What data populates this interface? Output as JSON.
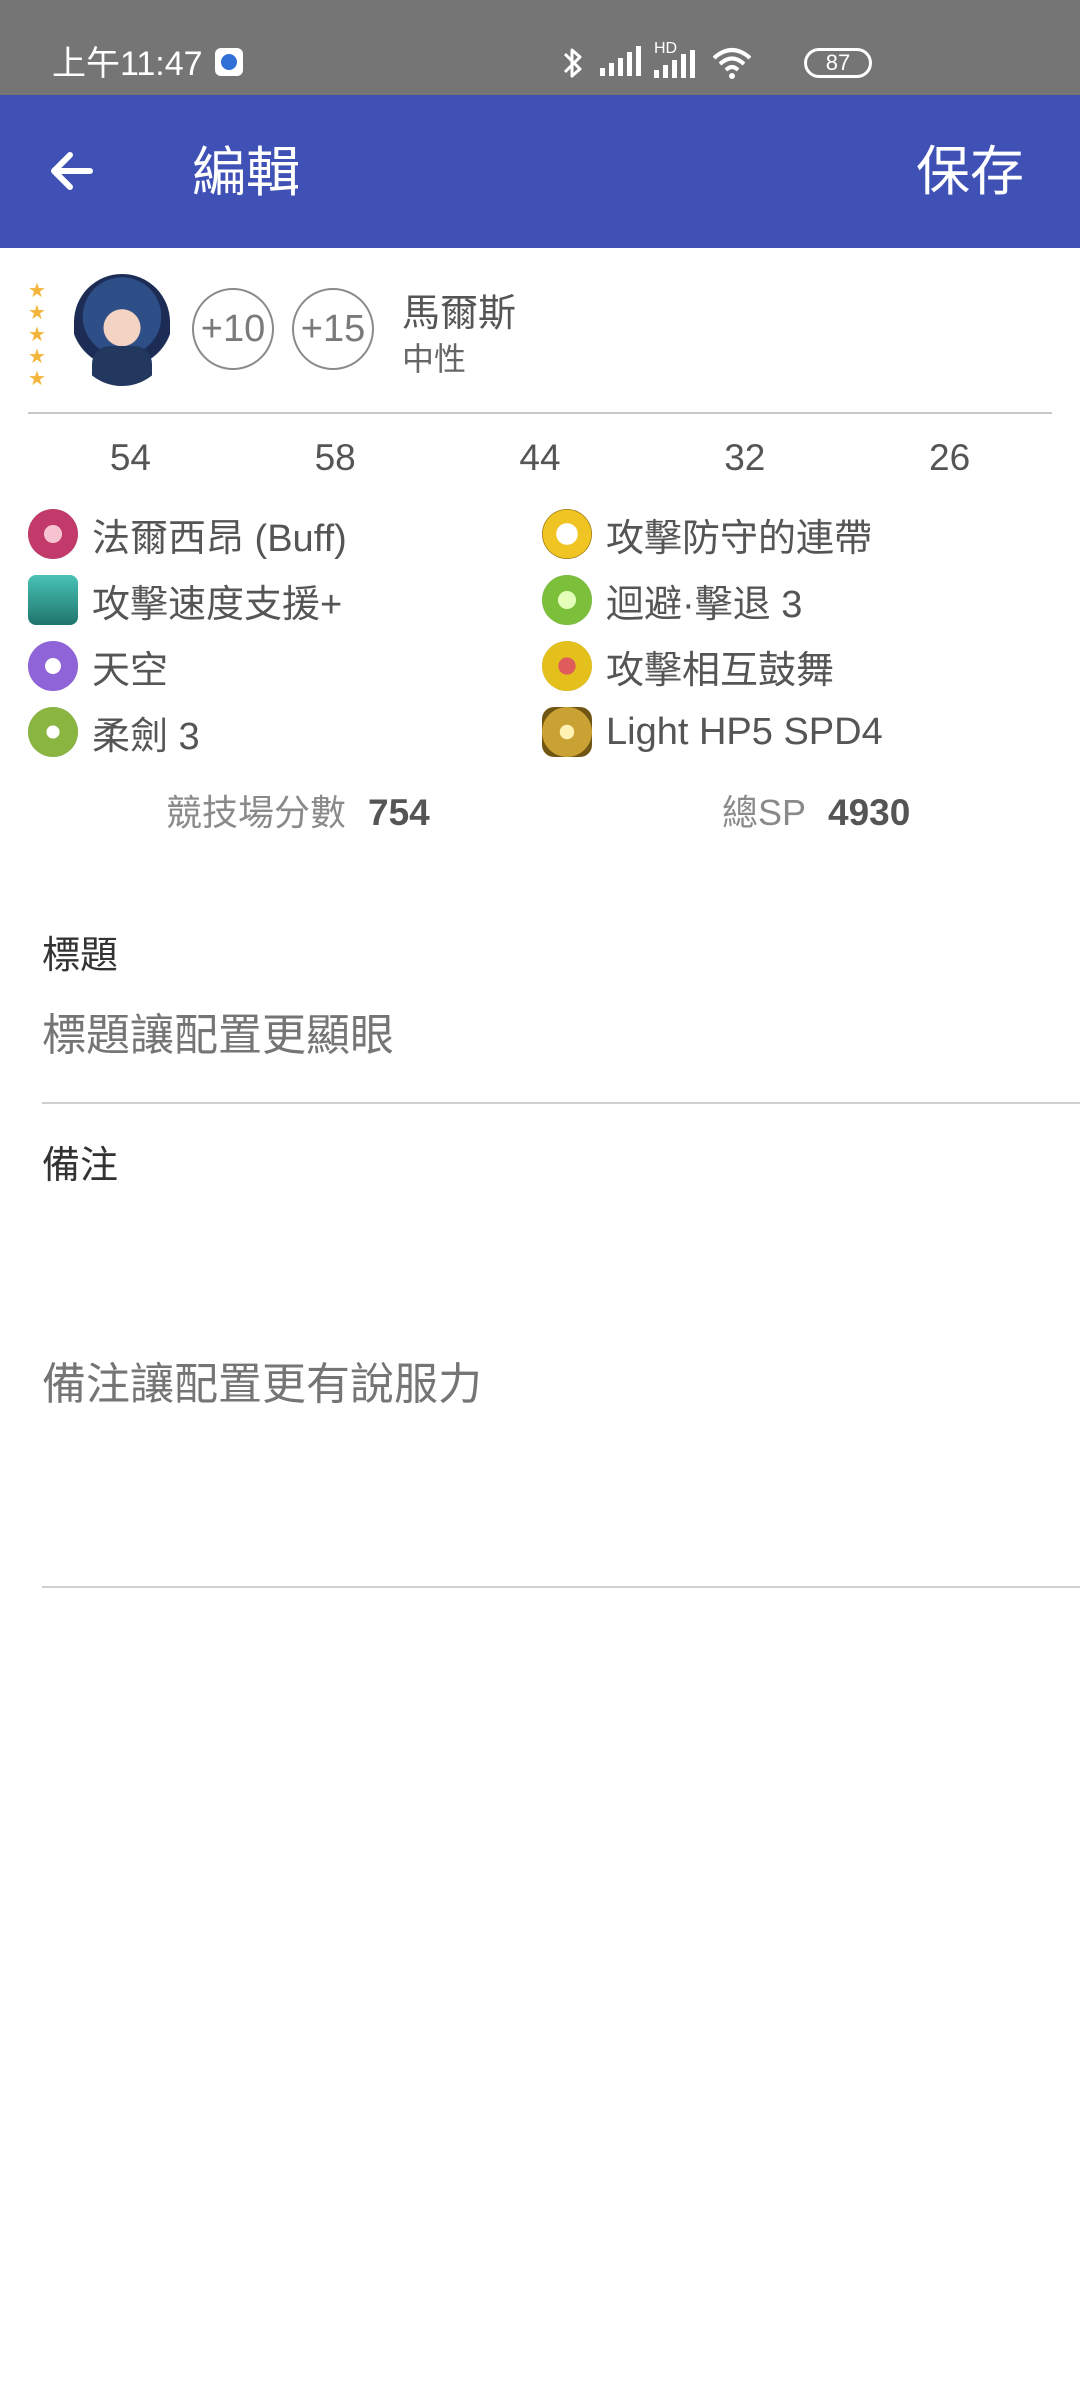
{
  "status_bar": {
    "time": "上午11:47",
    "battery": "87",
    "network_label": "HD"
  },
  "app_bar": {
    "title": "編輯",
    "save_label": "保存"
  },
  "hero": {
    "rarity_stars": 5,
    "merges": [
      "+10",
      "+15"
    ],
    "name": "馬爾斯",
    "type": "中性"
  },
  "stats": [
    "54",
    "58",
    "44",
    "32",
    "26"
  ],
  "skills": [
    {
      "name": "法爾西昂 (Buff)",
      "icon": "weapon-icon",
      "color": "#c23a6a"
    },
    {
      "name": "攻擊防守的連帶",
      "icon": "a-skill-icon",
      "color": "#f0c422"
    },
    {
      "name": "攻擊速度支援+",
      "icon": "assist-icon",
      "color": "#2c9a8f"
    },
    {
      "name": "迴避·擊退 3",
      "icon": "b-skill-icon",
      "color": "#7cbf3a"
    },
    {
      "name": "天空",
      "icon": "special-icon",
      "color": "#8f64d8"
    },
    {
      "name": "攻擊相互鼓舞",
      "icon": "c-skill-icon",
      "color": "#e4c01d"
    },
    {
      "name": "柔劍 3",
      "icon": "sacred-seal-icon",
      "color": "#8ab540"
    },
    {
      "name": "Light HP5 SPD4",
      "icon": "blessing-icon",
      "color": "#c9a233"
    }
  ],
  "scores": {
    "arena_label": "競技場分數",
    "arena_value": "754",
    "sp_label": "總SP",
    "sp_value": "4930"
  },
  "form": {
    "title_label": "標題",
    "title_placeholder": "標題讓配置更顯眼",
    "notes_label": "備注",
    "notes_placeholder": "備注讓配置更有說服力"
  }
}
